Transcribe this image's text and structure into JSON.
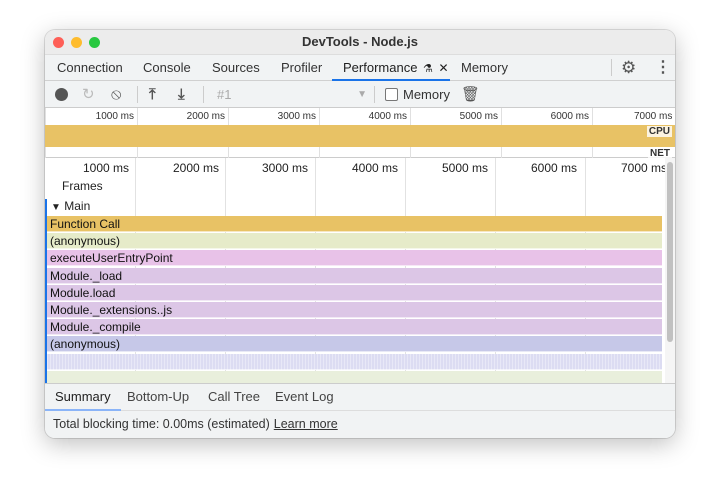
{
  "window": {
    "title": "DevTools - Node.js"
  },
  "tabs": [
    {
      "label": "Connection"
    },
    {
      "label": "Console"
    },
    {
      "label": "Sources"
    },
    {
      "label": "Profiler"
    },
    {
      "label": "Performance"
    },
    {
      "label": "Memory"
    }
  ],
  "toolbar": {
    "profile_select": "#1",
    "memory_label": "Memory",
    "memory_checked": false
  },
  "overview": {
    "ticks": [
      "1000 ms",
      "2000 ms",
      "3000 ms",
      "4000 ms",
      "5000 ms",
      "6000 ms",
      "7000 ms"
    ],
    "cpu_label": "CPU",
    "net_label": "NET"
  },
  "flame": {
    "ticks": [
      "1000 ms",
      "2000 ms",
      "3000 ms",
      "4000 ms",
      "5000 ms",
      "6000 ms",
      "7000 ms"
    ],
    "frames_label": "Frames",
    "main_label": "Main",
    "rows": [
      {
        "label": "Function Call",
        "color": "#e8c265"
      },
      {
        "label": "(anonymous)",
        "color": "#e6ebc9"
      },
      {
        "label": "executeUserEntryPoint",
        "color": "#e8c2e8"
      },
      {
        "label": "Module._load",
        "color": "#dcc6e6"
      },
      {
        "label": "Module.load",
        "color": "#dcc6e6"
      },
      {
        "label": "Module._extensions..js",
        "color": "#dcc6e6"
      },
      {
        "label": "Module._compile",
        "color": "#dcc6e6"
      },
      {
        "label": "(anonymous)",
        "color": "#c6c8e8"
      },
      {
        "label": "",
        "color": "#dcdcf2"
      },
      {
        "label": "",
        "color": "#e9efdc"
      }
    ]
  },
  "bottom_tabs": [
    {
      "label": "Summary"
    },
    {
      "label": "Bottom-Up"
    },
    {
      "label": "Call Tree"
    },
    {
      "label": "Event Log"
    }
  ],
  "status": {
    "text": "Total blocking time: 0.00ms (estimated)",
    "link": "Learn more"
  }
}
